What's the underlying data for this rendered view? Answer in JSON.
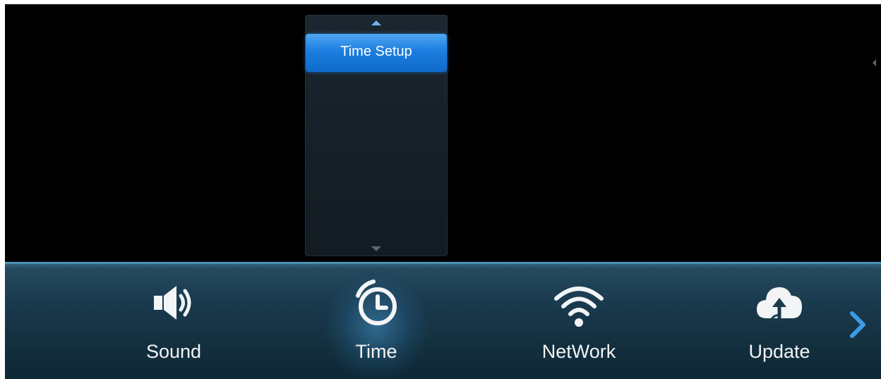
{
  "submenu": {
    "items": [
      {
        "label": "Time Setup",
        "selected": true
      }
    ]
  },
  "bottom_nav": {
    "items": [
      {
        "label": "Sound",
        "icon": "speaker-icon",
        "selected": false
      },
      {
        "label": "Time",
        "icon": "clock-icon",
        "selected": true
      },
      {
        "label": "NetWork",
        "icon": "wifi-icon",
        "selected": false
      },
      {
        "label": "Update",
        "icon": "cloud-update-icon",
        "selected": false
      }
    ],
    "next_icon": "chevron-right-icon"
  },
  "colors": {
    "screen_bg": "#000000",
    "accent": "#1b7ee0",
    "bar_bg": "#1a3a4e",
    "label": "#f2f4f5"
  }
}
